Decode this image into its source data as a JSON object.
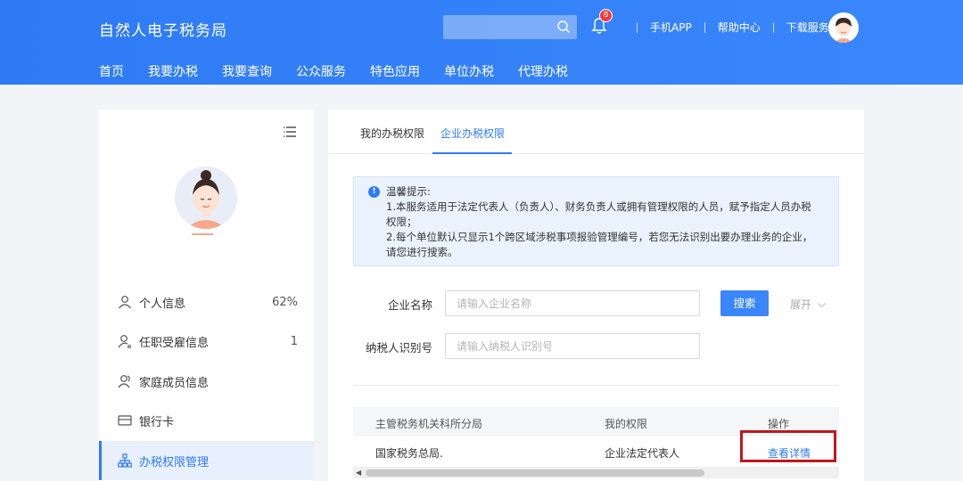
{
  "header": {
    "title": "自然人电子税务局",
    "search_placeholder": "",
    "notification_count": "8",
    "links": [
      "手机APP",
      "帮助中心",
      "下载服务"
    ],
    "nav": [
      "首页",
      "我要办税",
      "我要查询",
      "公众服务",
      "特色应用",
      "单位办税",
      "代理办税"
    ]
  },
  "sidebar": {
    "items": [
      {
        "label": "个人信息",
        "value": "62%",
        "icon": "person-icon"
      },
      {
        "label": "任职受雇信息",
        "value": "1",
        "icon": "person-employment-icon"
      },
      {
        "label": "家庭成员信息",
        "value": "",
        "icon": "family-icon"
      },
      {
        "label": "银行卡",
        "value": "",
        "icon": "bank-card-icon"
      },
      {
        "label": "办税权限管理",
        "value": "",
        "icon": "org-chart-icon"
      }
    ]
  },
  "main": {
    "tabs": [
      "我的办税权限",
      "企业办税权限"
    ],
    "active_tab": 1,
    "notice": {
      "title": "温馨提示:",
      "line1": "1.本服务适用于法定代表人（负责人）、财务负责人或拥有管理权限的人员，赋予指定人员办税权限；",
      "line2": "2.每个单位默认只显示1个跨区域涉税事项报验管理编号，若您无法识别出要办理业务的企业，请您进行搜索。"
    },
    "form": {
      "company_label": "企业名称",
      "company_placeholder": "请输入企业名称",
      "taxid_label": "纳税人识别号",
      "taxid_placeholder": "请输入纳税人识别号",
      "search_button": "搜索",
      "expand_label": "展开"
    },
    "table": {
      "headers": [
        "主管税务机关科所分局",
        "我的权限",
        "操作"
      ],
      "rows": [
        {
          "authority": "国家税务总局.",
          "permission": "企业法定代表人",
          "action": "查看详情"
        }
      ]
    }
  },
  "colors": {
    "accent": "#2f7bf5",
    "highlight_border": "#c0171b"
  }
}
